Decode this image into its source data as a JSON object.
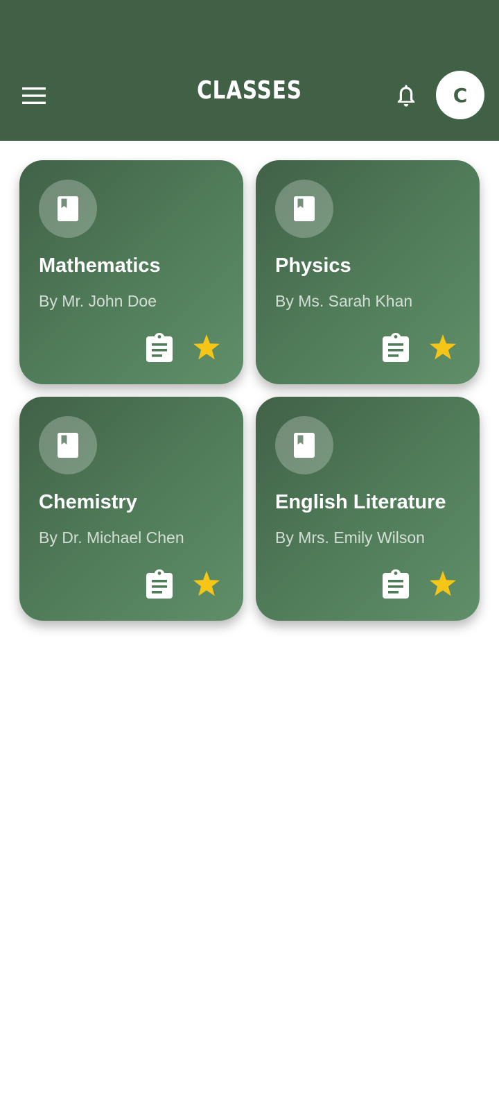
{
  "header": {
    "title": "CLASSES",
    "menu_icon": "menu-icon",
    "notification_icon": "bell-icon",
    "avatar_initial": "C",
    "background_color": "#416147"
  },
  "classes": [
    {
      "title": "Mathematics",
      "teacher": "By Mr. John Doe",
      "icon": "book-icon",
      "assignments_icon": "clipboard-icon",
      "favorite_icon": "star-icon"
    },
    {
      "title": "Physics",
      "teacher": "By Ms. Sarah Khan",
      "icon": "book-icon",
      "assignments_icon": "clipboard-icon",
      "favorite_icon": "star-icon"
    },
    {
      "title": "Chemistry",
      "teacher": "By Dr. Michael Chen",
      "icon": "book-icon",
      "assignments_icon": "clipboard-icon",
      "favorite_icon": "star-icon"
    },
    {
      "title": "English Literature",
      "teacher": "By Mrs. Emily Wilson",
      "icon": "book-icon",
      "assignments_icon": "clipboard-icon",
      "favorite_icon": "star-icon"
    }
  ],
  "colors": {
    "card_gradient_start": "#416147",
    "card_gradient_end": "#5f8f69",
    "star": "#f5c518",
    "icon": "#ffffff"
  }
}
